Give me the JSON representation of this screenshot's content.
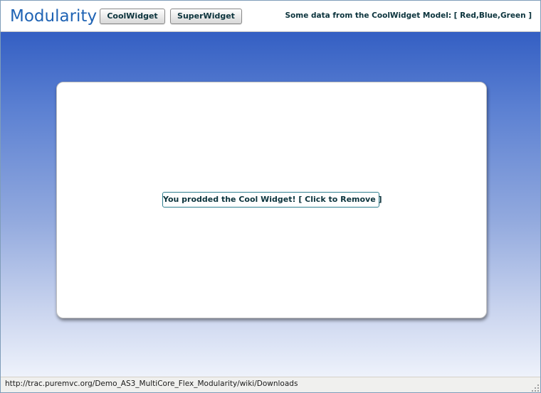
{
  "app": {
    "title": "Modularity"
  },
  "header": {
    "buttons": [
      {
        "label": "CoolWidget"
      },
      {
        "label": "SuperWidget"
      }
    ],
    "model_info": "Some data from the CoolWidget Model: [ Red,Blue,Green ]"
  },
  "panel": {
    "widget_button_label": "You prodded the Cool Widget! [ Click to Remove ]"
  },
  "status_bar": {
    "url": "http://trac.puremvc.org/Demo_AS3_MultiCore_Flex_Modularity/wiki/Downloads"
  },
  "colors": {
    "title": "#1f63b4",
    "background_top": "#345fc3",
    "background_bottom": "#eef2fb",
    "button_text": "#0b333c",
    "widget_button_border": "#2f7f8f"
  },
  "icons": {
    "status_grip": "resize-grip-icon"
  }
}
